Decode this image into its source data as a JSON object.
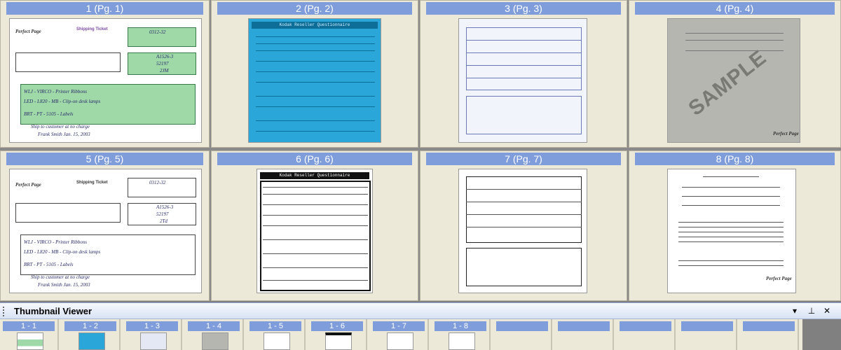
{
  "grid": {
    "pages": [
      {
        "label": "1 (Pg. 1)",
        "style": "white",
        "kind": "shipping-green",
        "doc_title": "Shipping Ticket",
        "number": "0312-32",
        "order_no": "A1526-3",
        "cust": "52197",
        "rep": "2JM",
        "lines": [
          "WLJ - VIRCO - Printer Ribbons",
          "LED - L820 - MB - Clip-on desk lamps",
          "BRT - PT - 5105 - Labels"
        ],
        "note": "Ship to customer at no charge",
        "sig": "Frank Smith   Jan. 15, 2003",
        "logo": "Perfect Page"
      },
      {
        "label": "2 (Pg. 2)",
        "style": "blue",
        "kind": "kodak",
        "doc_title": "Kodak Reseller Questionnaire"
      },
      {
        "label": "3 (Pg. 3)",
        "style": "lightblue",
        "kind": "report"
      },
      {
        "label": "4 (Pg. 4)",
        "style": "gray",
        "kind": "sample",
        "watermark": "SAMPLE",
        "logo": "Perfect Page"
      },
      {
        "label": "5 (Pg. 5)",
        "style": "white",
        "kind": "shipping",
        "doc_title": "Shipping Ticket",
        "number": "0312-32",
        "order_no": "A1526-3",
        "cust": "52197",
        "rep": "2Td",
        "lines": [
          "WLJ - VIRCO - Printer Ribbons",
          "LED - L820 - MB - Clip-on desk lamps",
          "BRT - PT - 5105 - Labels"
        ],
        "note": "Ship to customer at no charge",
        "sig": "Frank Smith   Jan. 15, 2003",
        "logo": "Perfect Page"
      },
      {
        "label": "6 (Pg. 6)",
        "style": "white",
        "kind": "kodak-bw",
        "doc_title": "Kodak Reseller Questionnaire"
      },
      {
        "label": "7 (Pg. 7)",
        "style": "white",
        "kind": "report-bw"
      },
      {
        "label": "8 (Pg. 8)",
        "style": "white",
        "kind": "legal",
        "logo": "Perfect Page"
      }
    ]
  },
  "thumbnail_viewer": {
    "title": "Thumbnail Viewer",
    "dropdown_icon": "chevron-down-icon",
    "pin_icon": "pin-icon",
    "close_icon": "close-icon",
    "items": [
      {
        "label": "1 - 1",
        "style": "white"
      },
      {
        "label": "1 - 2",
        "style": "blue"
      },
      {
        "label": "1 - 3",
        "style": "white"
      },
      {
        "label": "1 - 4",
        "style": "gray"
      },
      {
        "label": "1 - 5",
        "style": "white"
      },
      {
        "label": "1 - 6",
        "style": "white"
      },
      {
        "label": "1 - 7",
        "style": "white"
      },
      {
        "label": "1 - 8",
        "style": "white"
      },
      {
        "label": "",
        "style": "empty"
      },
      {
        "label": "",
        "style": "empty"
      },
      {
        "label": "",
        "style": "empty"
      },
      {
        "label": "",
        "style": "empty"
      },
      {
        "label": "",
        "style": "empty"
      }
    ]
  },
  "colors": {
    "label_bg": "#7f9ddb",
    "panel_bg": "#ece9d8",
    "kodak_blue": "#2aa6d8"
  }
}
